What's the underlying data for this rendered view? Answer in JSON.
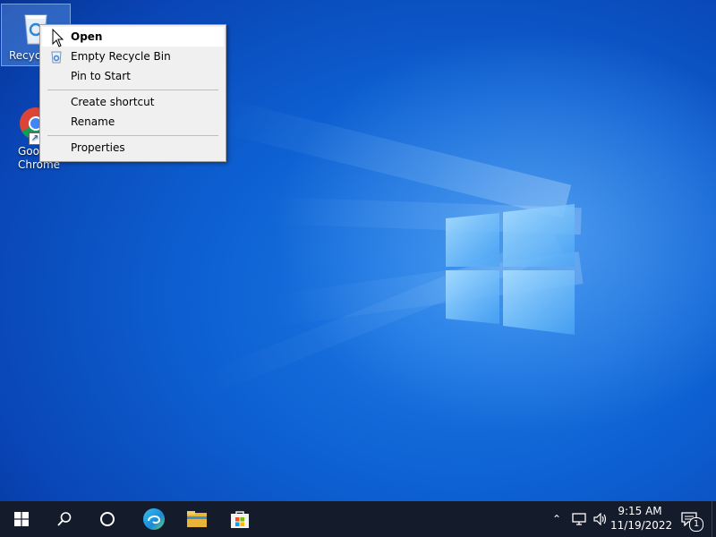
{
  "desktop": {
    "icons": [
      {
        "label": "Recycle Bin",
        "visible_label": "Recyc"
      },
      {
        "label_line1": "Goo",
        "label_line2": "Chrome"
      }
    ]
  },
  "context_menu": {
    "items": [
      {
        "label": "Open"
      },
      {
        "label": "Empty Recycle Bin"
      },
      {
        "label": "Pin to Start"
      },
      {
        "label": "Create shortcut"
      },
      {
        "label": "Rename"
      },
      {
        "label": "Properties"
      }
    ]
  },
  "taskbar": {
    "buttons": [
      {
        "icon": "windows-start-icon"
      },
      {
        "icon": "search-icon"
      },
      {
        "icon": "cortana-icon"
      },
      {
        "icon": "edge-icon"
      },
      {
        "icon": "file-explorer-icon"
      },
      {
        "icon": "store-icon"
      }
    ],
    "tray": {
      "time": "9:15 AM",
      "date": "11/19/2022",
      "notification_count": "1"
    }
  },
  "colors": {
    "desktop_blue": "#0a4fc4",
    "taskbar": "#141b2b",
    "menu_bg": "#f0f0f0"
  }
}
